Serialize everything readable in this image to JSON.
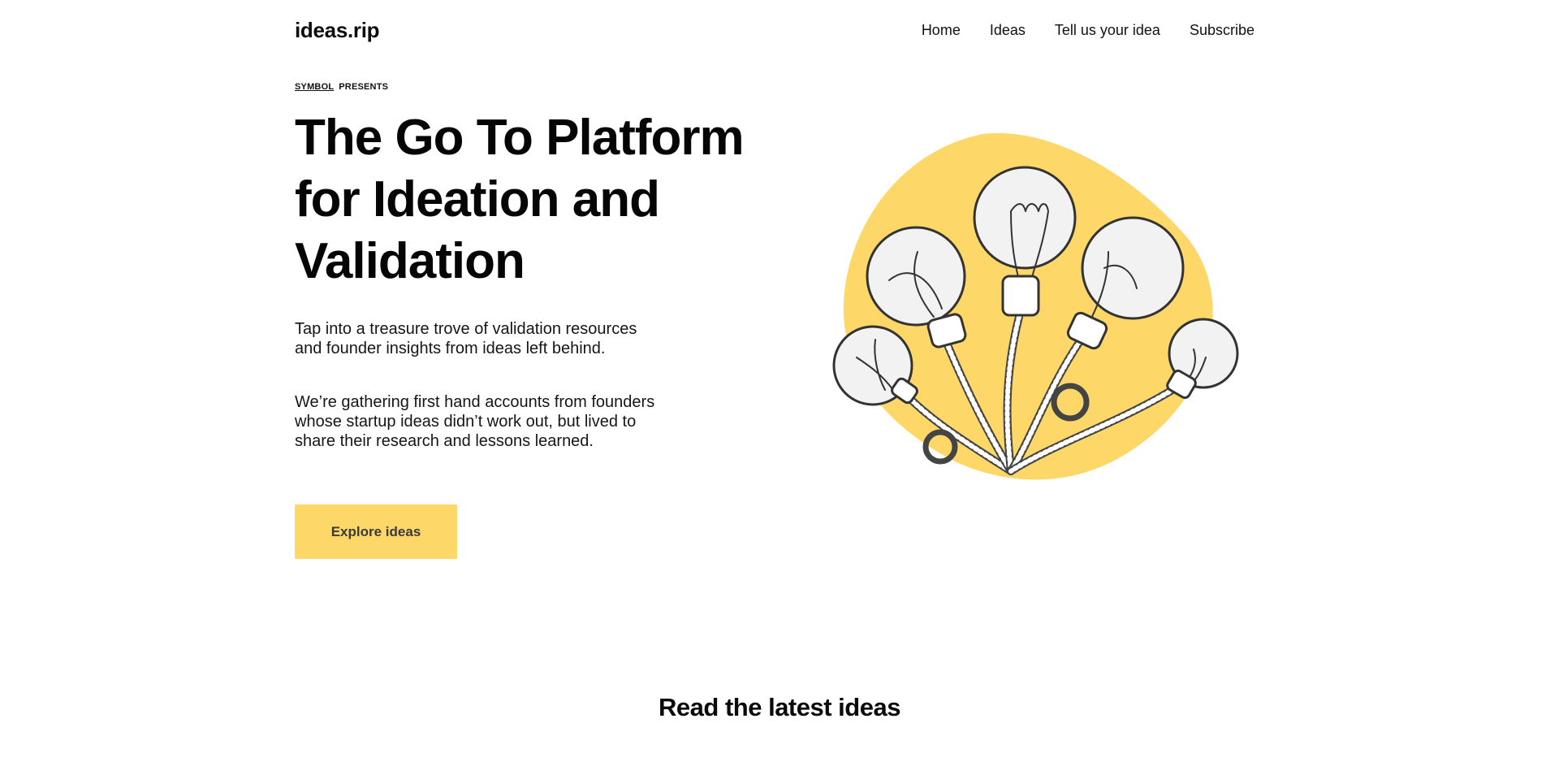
{
  "header": {
    "logo": "ideas.rip",
    "nav": [
      {
        "label": "Home"
      },
      {
        "label": "Ideas"
      },
      {
        "label": "Tell us your idea"
      },
      {
        "label": "Subscribe"
      }
    ]
  },
  "hero": {
    "presenter_brand": "SYMBOL",
    "presents_label": "PRESENTS",
    "title": "The Go To Platform for Ideation and Validation",
    "paragraph_1": "Tap into a treasure trove of validation resources and founder insights from ideas left behind.",
    "paragraph_2": "We’re gathering first hand accounts from founders whose startup ideas didn’t work out, but lived to share their research and lessons learned.",
    "cta_label": "Explore ideas",
    "illustration": "lightbulbs-illustration",
    "colors": {
      "accent": "#fdd767",
      "text": "#0c0c0c",
      "background": "#ffffff"
    }
  },
  "latest": {
    "title": "Read the latest ideas"
  }
}
